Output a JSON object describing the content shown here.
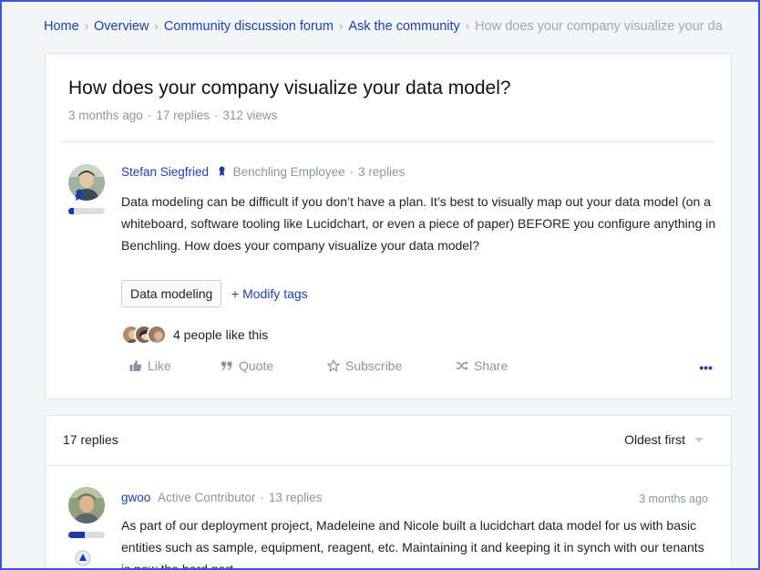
{
  "breadcrumb": {
    "home": "Home",
    "overview": "Overview",
    "forum": "Community discussion forum",
    "ask": "Ask the community",
    "current": "How does your company visualize your da",
    "separator": "›"
  },
  "topic": {
    "title": "How does your company visualize your data model?",
    "age": "3 months ago",
    "replies": "17 replies",
    "views": "312 views",
    "meta_dot": "·"
  },
  "post": {
    "author": "Stefan Siegfried",
    "role": "Benchling Employee",
    "reply_count": "3 replies",
    "body": "Data modeling can be difficult if you don’t have a plan. It’s best to visually map out your data model (on a whiteboard, software tooling like Lucidchart, or even a piece of paper) BEFORE you configure anything in Benchling. How does your company visualize your data model?",
    "rank_level": 0.15,
    "tag": "Data modeling",
    "modify_tags": "+ Modify tags",
    "likes_text": "4 people like this",
    "actions": {
      "like": "Like",
      "quote": "Quote",
      "subscribe": "Subscribe",
      "share": "Share",
      "more": "•••"
    },
    "icons": {
      "like": "thumbs-up-icon",
      "quote": "quote-icon",
      "subscribe": "star-icon",
      "share": "shuffle-share-icon",
      "badge": "employee-badge-icon"
    }
  },
  "replies_section": {
    "count_label": "17 replies",
    "sort_label": "Oldest first"
  },
  "reply": {
    "author": "gwoo",
    "role": "Active Contributor",
    "reply_count": "13 replies",
    "time": "3 months ago",
    "body": "As part of our deployment project, Madeleine and Nicole built a lucidchart data model for us with basic entities such as sample, equipment, reagent, etc. Maintaining it and keeping it in synch with our tenants is now the hard part.",
    "rank_level": 0.45
  },
  "colors": {
    "link": "#1d3fb6",
    "muted": "#8c93a1",
    "rank_fill": "#1b3aa6",
    "frame_border": "#3a56e0"
  }
}
